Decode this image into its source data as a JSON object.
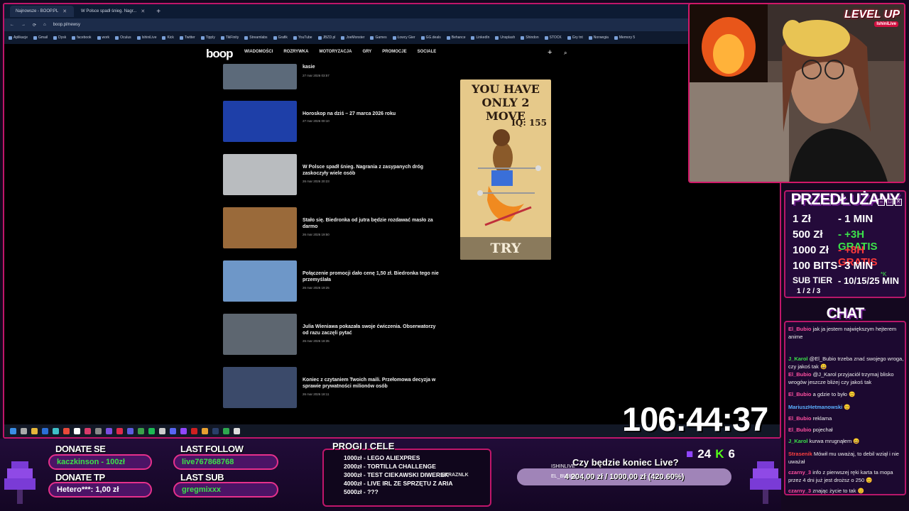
{
  "browser": {
    "tabs": [
      {
        "label": "Najnowsze - BOOP.PL",
        "active": true
      },
      {
        "label": "W Polsce spadł śnieg. Nagr...",
        "active": false
      }
    ],
    "url": "boop.pl/newsy",
    "bookmarks": [
      "Aplikacje",
      "Gmail",
      "Dysk",
      "facebook",
      "work",
      "Oculus",
      "IshiniLive",
      "Kick",
      "Twitter",
      "Tipply",
      "TikFinity",
      "Streamlabs",
      "Grafik",
      "YouTube",
      "JBZD.pl",
      "JoeMonster",
      "Games",
      "Łowcy Gier",
      "GG.deals",
      "Behance",
      "LinkedIn",
      "Unsplash",
      "Shindon",
      "STOCK",
      "Gry tnt",
      "Norwegia",
      "Memory 5"
    ]
  },
  "site": {
    "logo": "boop",
    "nav": [
      "WIADOMOŚCI",
      "ROZRYWKA",
      "MOTORYZACJA",
      "GRY",
      "PROMOCJE",
      "SOCIALE"
    ],
    "plus": "+",
    "search": "⌕",
    "articles": [
      {
        "title": "kasie",
        "date": "27 mar 2026 03:57",
        "thumb": "#5c6a7a"
      },
      {
        "title": "Horoskop na dziś – 27 marca 2026 roku",
        "date": "27 mar 2026 00:10",
        "thumb": "#1e3fa8"
      },
      {
        "title": "W Polsce spadł śnieg. Nagrania z zasypanych dróg zaskoczyły wiele osób",
        "date": "26 mar 2026 20:23",
        "thumb": "#b9bcbf"
      },
      {
        "title": "Stało się. Biedronka od jutra będzie rozdawać masło za darmo",
        "date": "26 mar 2026 19:50",
        "thumb": "#9a6a3a"
      },
      {
        "title": "Połączenie promocji dało cenę 1,50 zł. Biedronka tego nie przemyślała",
        "date": "26 mar 2026 19:25",
        "thumb": "#6e97c8"
      },
      {
        "title": "Julia Wieniawa pokazała swoje ćwiczenia. Obserwatorzy od razu zaczęli pytać",
        "date": "26 mar 2026 18:35",
        "thumb": "#5d6670"
      },
      {
        "title": "Koniec z czytaniem Twoich maili. Przełomowa decyzja w sprawie prywatności milionów osób",
        "date": "26 mar 2026 18:11",
        "thumb": "#3b4a6a"
      }
    ],
    "ad": {
      "headline": "YOU HAVE ONLY 2 MOVE",
      "iq": "IQ: 155",
      "cta": "TRY"
    }
  },
  "webcam": {
    "badge": "LEVEL UP",
    "badge_sub": "IshiniLive"
  },
  "extend": {
    "title": "PRZEDŁUŻANY",
    "rates": [
      {
        "left": "1 Zł",
        "right": "- 1 MIN",
        "color": "white"
      },
      {
        "left": "500 Zł",
        "right": "- +3H GRATIS",
        "color": "green"
      },
      {
        "left": "1000 Zł",
        "right": "- +8H GRATIS",
        "color": "red"
      },
      {
        "left": "100 BITS",
        "right": "- 3 MIN",
        "color": "white"
      },
      {
        "left": "SUB TIER",
        "right": "- 10/15/25 MIN",
        "color": "white"
      }
    ],
    "subtier_levels": "1 / 2 / 3",
    "star": "*K"
  },
  "chat": {
    "title": "CHAT",
    "messages": [
      {
        "user": "El_Bubio",
        "text": "jak ja jestem największym hejterem anime",
        "color": "#ff4fa0"
      },
      {
        "user": "El_Bubio",
        "text": "",
        "color": "#ff4fa0"
      },
      {
        "user": "J_Karol",
        "text": "@El_Bubio trzeba znać swojego wroga, czy jakoś tak 😄",
        "color": "#3be24a"
      },
      {
        "user": "El_Bubio",
        "text": "@J_Karol przyjaciół trzymaj blisko wrogów jeszcze bliżej czy jakoś tak",
        "color": "#ff4fa0"
      },
      {
        "user": "El_Bubio",
        "text": "a gdzie to było 😊",
        "color": "#ff4fa0"
      },
      {
        "user": "MariuszHetmanowski",
        "text": "😊",
        "color": "#5ab0ff"
      },
      {
        "user": "El_Bubio",
        "text": "reklama",
        "color": "#ff4fa0"
      },
      {
        "user": "El_Bubio",
        "text": "pojechał",
        "color": "#ff4fa0"
      },
      {
        "user": "J_Karol",
        "text": "kurwa mrugnąłem 😄",
        "color": "#3be24a"
      },
      {
        "user": "Strasenik",
        "text": "Mówił mu uważaj, to debil wziął i nie uważał",
        "color": "#ff4040"
      },
      {
        "user": "czarny_3",
        "text": "info z pierwszej ręki karta ta mopa przez 4 dni już jest droższ o 250 😊",
        "color": "#ff4fa0"
      },
      {
        "user": "czarny_3",
        "text": "znając życie to tak 😊",
        "color": "#ff4fa0"
      }
    ]
  },
  "timer": "106:44:37",
  "bottom": {
    "donate_se_label": "DONATE SE",
    "donate_se_value": "kaczkinson - 100zł",
    "donate_tp_label": "DONATE TP",
    "donate_tp_value": "Hetero***: 1,00 zł",
    "last_follow_label": "LAST FOLLOW",
    "last_follow_value": "live767868768",
    "last_sub_label": "LAST SUB",
    "last_sub_value": "gregmixxx",
    "progi_title": "PROGI I CELE",
    "progi": [
      "1000zł - LEGO ALIEXPRES",
      "2000zł - TORTILLA CHALLENGE",
      "3000zł - TEST CIEKAWSKI DIWEREK",
      "4000zł - LIVE IRL ZE SPRZĘTU Z ARIA",
      "5000zł - ???"
    ],
    "straznik": "STRAZNLK",
    "goal_question": "Czy będzie koniec Live?",
    "goal_text": "4 204,00 zł / 1000,00 zł (420.60%)",
    "goal_progress": 1.0,
    "goal_overlay_1": "ISHINLIVE",
    "goal_overlay_2": "EL_BUBIO",
    "viewers": "24",
    "kick": "6"
  }
}
